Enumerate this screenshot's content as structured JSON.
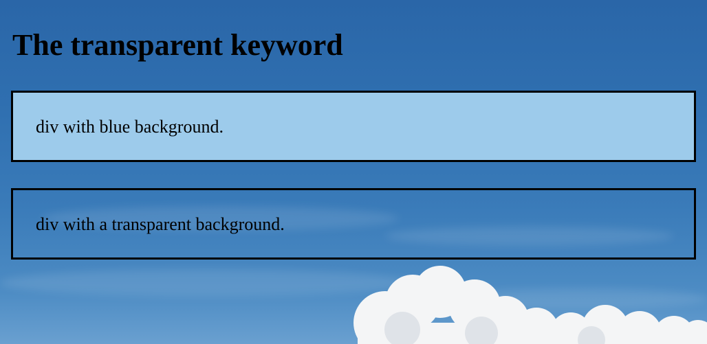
{
  "page": {
    "title": "The transparent keyword",
    "background_image": "sky-with-clouds"
  },
  "boxes": {
    "blue": {
      "text": "div with blue background.",
      "background_color": "#9dcbeb",
      "border_color": "#000000"
    },
    "transparent": {
      "text": "div with a transparent background.",
      "background_color": "transparent",
      "border_color": "#000000"
    }
  }
}
